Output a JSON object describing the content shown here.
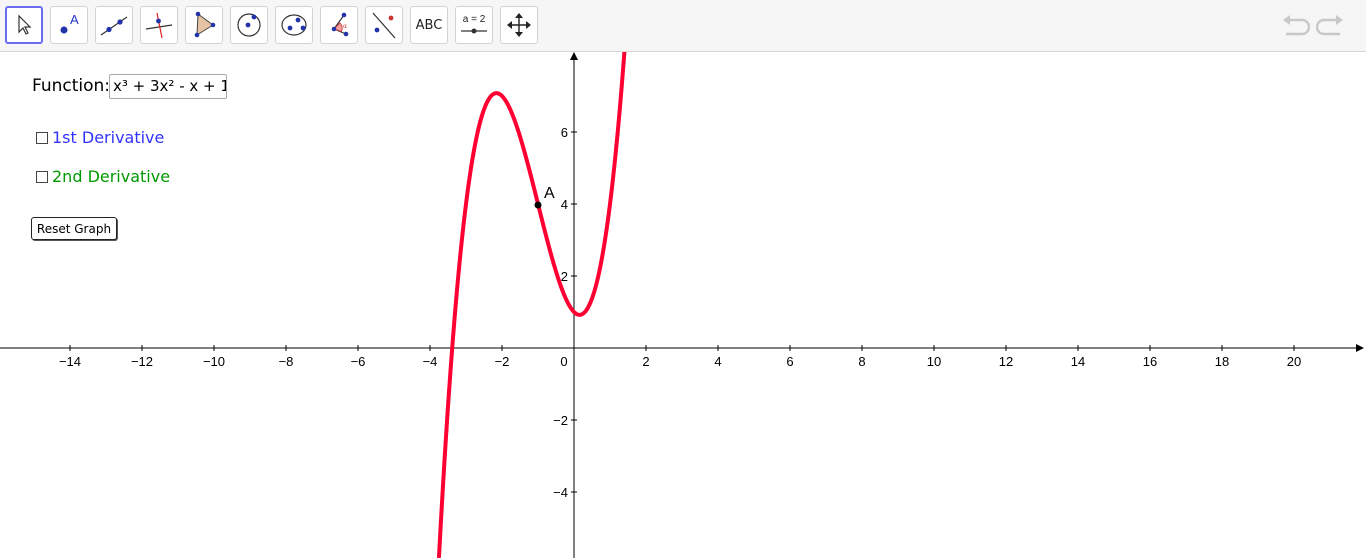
{
  "toolbar": {
    "tools": [
      {
        "name": "move-tool",
        "icon": "cursor-arrow-icon"
      },
      {
        "name": "point-tool",
        "icon": "point-icon",
        "label": "A"
      },
      {
        "name": "line-tool",
        "icon": "line-icon"
      },
      {
        "name": "perpendicular-tool",
        "icon": "perpendicular-line-icon"
      },
      {
        "name": "polygon-tool",
        "icon": "polygon-icon"
      },
      {
        "name": "circle-tool",
        "icon": "circle-icon"
      },
      {
        "name": "ellipse-tool",
        "icon": "ellipse-icon"
      },
      {
        "name": "angle-tool",
        "icon": "angle-icon"
      },
      {
        "name": "reflect-tool",
        "icon": "reflect-icon"
      },
      {
        "name": "text-tool",
        "icon": "text-icon",
        "label": "ABC"
      },
      {
        "name": "slider-tool",
        "icon": "slider-icon",
        "label": "a = 2"
      },
      {
        "name": "move-graphics-tool",
        "icon": "move-arrows-icon"
      }
    ],
    "undo_icon": "undo-icon",
    "redo_icon": "redo-icon"
  },
  "panel": {
    "function_label": "Function:",
    "function_value": "x³ + 3x² - x + 1",
    "checkbox1_label": "1st Derivative",
    "checkbox1_checked": false,
    "checkbox2_label": "2nd Derivative",
    "checkbox2_checked": false,
    "reset_label": "Reset Graph"
  },
  "graph": {
    "point_label": "A",
    "point": [
      -1,
      4
    ],
    "curve_color": "#ff0033",
    "x_ticks": [
      "−14",
      "−12",
      "−10",
      "−8",
      "−6",
      "−4",
      "−2",
      "0",
      "2",
      "4",
      "6",
      "8",
      "10",
      "12",
      "14",
      "16",
      "18",
      "20"
    ],
    "x_tick_values": [
      -14,
      -12,
      -10,
      -8,
      -6,
      -4,
      -2,
      0,
      2,
      4,
      6,
      8,
      10,
      12,
      14,
      16,
      18,
      20
    ],
    "y_ticks": [
      "6",
      "4",
      "2",
      "−2",
      "−4"
    ],
    "y_tick_values": [
      6,
      4,
      2,
      -2,
      -4
    ]
  },
  "colors": {
    "checkbox1": "#3333ff",
    "checkbox2": "#009900",
    "active_tool_border": "#6c6cf0"
  }
}
